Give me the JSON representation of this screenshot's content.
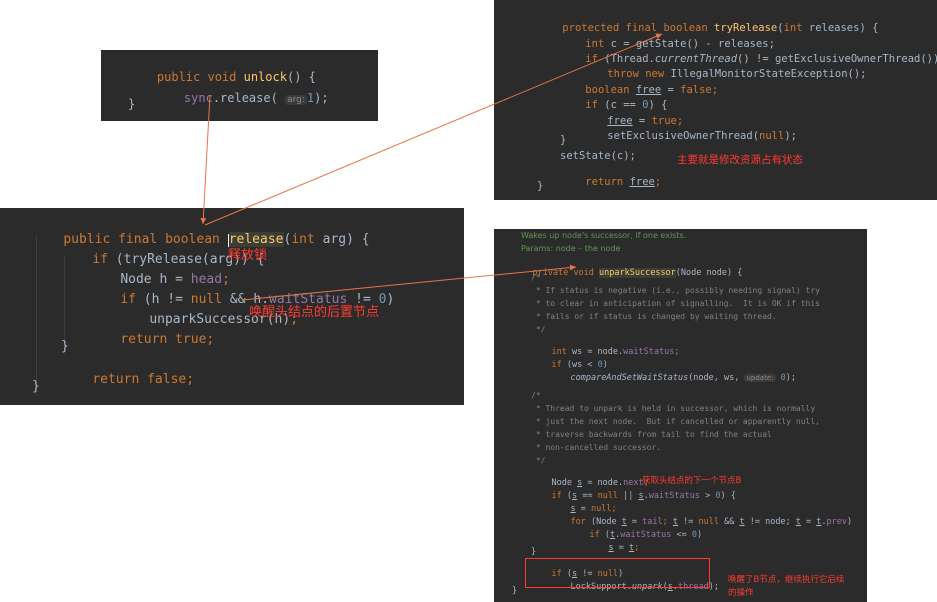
{
  "unlock_panel": {
    "line1": {
      "a": "public ",
      "b": "void ",
      "c": "unlock",
      "d": "() {"
    },
    "line2": {
      "a": "sync",
      "b": ".release( ",
      "hint": "arg:",
      "num": "1",
      "end": ");"
    },
    "line3": "}"
  },
  "release_panel": {
    "l1": {
      "a": "public ",
      "b": "final ",
      "c": "boolean ",
      "d": "release",
      "e": "(",
      "f": "int ",
      "g": "arg) {"
    },
    "l2": {
      "a": "if ",
      "b": "(tryRelease(arg)) {"
    },
    "l3": {
      "a": "Node h = ",
      "b": "head",
      "c": ";"
    },
    "l4": {
      "a": "if ",
      "b": "(h != ",
      "c": "null ",
      "d": "&& h.",
      "e": "waitStatus",
      "f": " != ",
      "g": "0",
      "h": ")"
    },
    "l5": {
      "a": "unparkSuccessor(h)",
      "b": ";"
    },
    "l6": {
      "a": "return ",
      "b": "true",
      "c": ";"
    },
    "l7": "}",
    "l8": {
      "a": "return ",
      "b": "false",
      "c": ";"
    },
    "l9": "}",
    "ann_release": "释放锁",
    "ann_wake": "唤醒头结点的后置节点"
  },
  "tryrelease_panel": {
    "l1": {
      "a": "protected ",
      "b": "final ",
      "c": "boolean ",
      "d": "tryRelease",
      "e": "(",
      "f": "int ",
      "g": "releases) {"
    },
    "l2": {
      "a": "int ",
      "b": "c = getState() - releases;"
    },
    "l3": {
      "a": "if ",
      "b": "(Thread.",
      "c": "currentThread",
      "d": "() != getExclusiveOwnerThread())"
    },
    "l4": {
      "a": "throw new ",
      "b": "IllegalMonitorStateException();"
    },
    "l5": {
      "a": "boolean ",
      "b": "free",
      "c": " = ",
      "d": "false",
      "e": ";"
    },
    "l6": {
      "a": "if ",
      "b": "(c == ",
      "c": "0",
      "d": ") {"
    },
    "l7": {
      "a": "free",
      "b": " = ",
      "c": "true",
      "d": ";"
    },
    "l8": {
      "a": "setExclusiveOwnerThread(",
      "b": "null",
      "c": ");"
    },
    "l9": "}",
    "l10": "setState(c);",
    "l11": {
      "a": "return ",
      "b": "free",
      "c": ";"
    },
    "l12": "}",
    "ann_main": "主要就是修改资源占有状态"
  },
  "unpark_panel": {
    "doc1": "Wakes up node's successor, if one exists.",
    "doc2": "Params: node – the node",
    "l1": {
      "a": "private ",
      "b": "void ",
      "c": "unparkSuccessor",
      "d": "(Node node) {"
    },
    "c1": "/*",
    "c2": " * If status is negative (i.e., possibly needing signal) try",
    "c3": " * to clear in anticipation of signalling.  It is OK if this",
    "c4": " * fails or if status is changed by waiting thread.",
    "c5": " */",
    "l2": {
      "a": "int ",
      "b": "ws = node.",
      "c": "waitStatus",
      "d": ";"
    },
    "l3": {
      "a": "if ",
      "b": "(ws < ",
      "c": "0",
      "d": ")"
    },
    "l4": {
      "a": "compareAndSetWaitStatus",
      "b": "(node, ws, ",
      "hint": "update:",
      "c": "0",
      "d": ");"
    },
    "c6": "/*",
    "c7": " * Thread to unpark is held in successor, which is normally",
    "c8": " * just the next node.  But if cancelled or apparently null,",
    "c9": " * traverse backwards from tail to find the actual",
    "c10": " * non-cancelled successor.",
    "c11": " */",
    "l5": {
      "a": "Node ",
      "b": "s",
      "c": " = node.",
      "d": "next",
      "e": ";"
    },
    "l6": {
      "a": "if ",
      "b": "(",
      "c": "s",
      "d": " == ",
      "e": "null",
      "f": " || ",
      "g": "s",
      "h": ".",
      "i": "waitStatus",
      "j": " > ",
      "k": "0",
      "l": ") {"
    },
    "l7": {
      "a": "s",
      "b": " = ",
      "c": "null",
      "d": ";"
    },
    "l8": {
      "a": "for ",
      "b": "(Node ",
      "c": "t",
      "d": " = ",
      "e": "tail",
      "f": "; ",
      "g": "t",
      "h": " != ",
      "i": "null",
      "j": " && ",
      "k": "t",
      "l": " != node; ",
      "m": "t",
      "n": " = ",
      "o": "t",
      "p": ".",
      "q": "prev",
      "r": ")"
    },
    "l9": {
      "a": "if ",
      "b": "(",
      "c": "t",
      "d": ".",
      "e": "waitStatus",
      "f": " <= ",
      "g": "0",
      "h": ")"
    },
    "l10": {
      "a": "s",
      "b": " = ",
      "c": "t",
      "d": ";"
    },
    "l11": "}",
    "l12": {
      "a": "if ",
      "b": "(",
      "c": "s",
      "d": " != ",
      "e": "null",
      "f": ")"
    },
    "l13": {
      "a": "LockSupport.",
      "b": "unpark",
      "c": "(",
      "d": "s",
      "e": ".",
      "f": "thread",
      "g": ");"
    },
    "l14": "}",
    "ann_getnext": "获取头结点的下一个节点B",
    "ann_wakeb1": "唤醒了B节点，继续执行它后续",
    "ann_wakeb2": "的操作"
  },
  "colors": {
    "bg": "#2b2b2b",
    "keyword": "#cc7832",
    "function": "#ffc66d",
    "number": "#6897bb",
    "field": "#9876aa",
    "text": "#a9b7c6",
    "comment": "#808080",
    "annotation": "#ff3b30",
    "arrow": "#e8734a"
  }
}
